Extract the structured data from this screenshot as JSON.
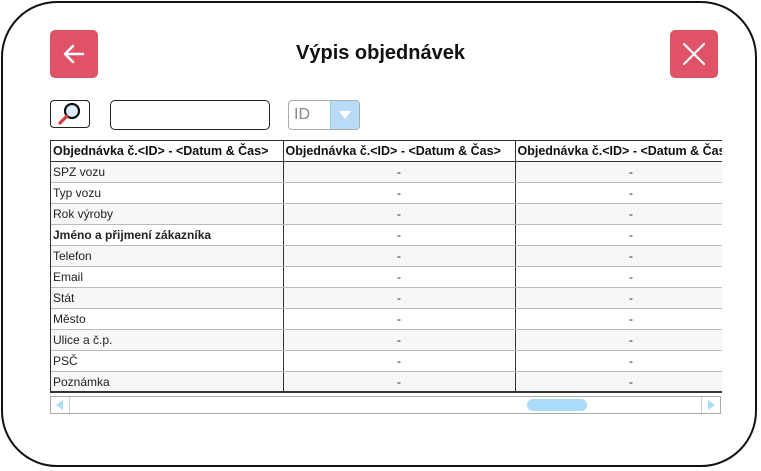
{
  "header": {
    "title": "Výpis objednávek",
    "back_icon": "arrow-left-icon",
    "close_icon": "close-icon",
    "accent_color": "#e05366"
  },
  "search": {
    "icon": "magnifier-icon",
    "value": "",
    "filter_selected": "ID"
  },
  "table": {
    "columns": [
      "Objednávka č.<ID> - <Datum & Čas>",
      "Objednávka č.<ID> - <Datum & Čas>",
      "Objednávka č.<ID> - <Datum & Čas>"
    ],
    "rows": [
      {
        "label": "SPZ vozu",
        "bold": false,
        "values": [
          "-",
          "-"
        ]
      },
      {
        "label": "Typ vozu",
        "bold": false,
        "values": [
          "-",
          "-"
        ]
      },
      {
        "label": "Rok výroby",
        "bold": false,
        "values": [
          "-",
          "-"
        ]
      },
      {
        "label": "Jméno a přijmení zákazníka",
        "bold": true,
        "values": [
          "-",
          "-"
        ]
      },
      {
        "label": "Telefon",
        "bold": false,
        "values": [
          "-",
          "-"
        ]
      },
      {
        "label": "Email",
        "bold": false,
        "values": [
          "-",
          "-"
        ]
      },
      {
        "label": "Stát",
        "bold": false,
        "values": [
          "-",
          "-"
        ]
      },
      {
        "label": "Město",
        "bold": false,
        "values": [
          "-",
          "-"
        ]
      },
      {
        "label": "Ulice a č.p.",
        "bold": false,
        "values": [
          "-",
          "-"
        ]
      },
      {
        "label": "PSČ",
        "bold": false,
        "values": [
          "-",
          "-"
        ]
      },
      {
        "label": "Poznámka",
        "bold": false,
        "values": [
          "-",
          "-"
        ]
      }
    ]
  },
  "scrollbar": {
    "left_icon": "scroll-left-arrow-icon",
    "right_icon": "scroll-right-arrow-icon",
    "thumb_color": "#a9dcf8"
  }
}
